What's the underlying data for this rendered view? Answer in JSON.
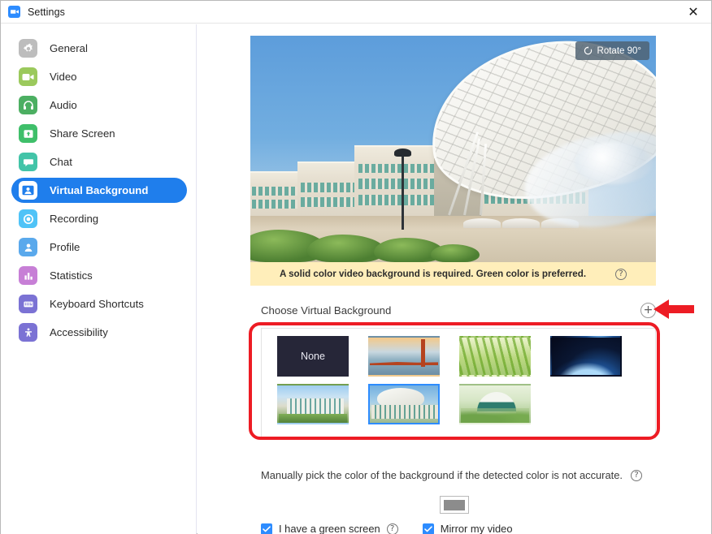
{
  "window": {
    "title": "Settings",
    "logo_icon": "zoom-logo-icon",
    "close_icon": "close-icon"
  },
  "sidebar": {
    "items": [
      {
        "label": "General",
        "icon": "gear-icon",
        "color": "#b9b9b9",
        "active": false
      },
      {
        "label": "Video",
        "icon": "video-icon",
        "color": "#9bc95c",
        "active": false
      },
      {
        "label": "Audio",
        "icon": "headphones-icon",
        "color": "#4caf62",
        "active": false
      },
      {
        "label": "Share Screen",
        "icon": "share-icon",
        "color": "#3fbf6a",
        "active": false
      },
      {
        "label": "Chat",
        "icon": "chat-icon",
        "color": "#42c4a8",
        "active": false
      },
      {
        "label": "Virtual Background",
        "icon": "person-icon",
        "color": "#ffffff",
        "active": true
      },
      {
        "label": "Recording",
        "icon": "record-icon",
        "color": "#4fc3f7",
        "active": false
      },
      {
        "label": "Profile",
        "icon": "profile-icon",
        "color": "#5aa9ec",
        "active": false
      },
      {
        "label": "Statistics",
        "icon": "bar-chart-icon",
        "color": "#c77fd6",
        "active": false
      },
      {
        "label": "Keyboard Shortcuts",
        "icon": "keyboard-icon",
        "color": "#7b72d4",
        "active": false
      },
      {
        "label": "Accessibility",
        "icon": "accessibility-icon",
        "color": "#7b72d4",
        "active": false
      }
    ],
    "active_color": "#1f7eec"
  },
  "main": {
    "preview": {
      "rotate_label": "Rotate 90°",
      "rotate_icon": "rotate-icon"
    },
    "warning": {
      "text": "A solid color video background is required. Green color is preferred.",
      "help_icon": "question-mark-icon",
      "background_color": "#ffeeba"
    },
    "choose": {
      "label": "Choose Virtual Background",
      "add_icon": "plus-circle-icon"
    },
    "thumbnails": [
      {
        "name": "none",
        "label": "None",
        "selected": false
      },
      {
        "name": "golden-gate",
        "label": "",
        "selected": false
      },
      {
        "name": "grass",
        "label": "",
        "selected": false
      },
      {
        "name": "earth",
        "label": "",
        "selected": false
      },
      {
        "name": "campus",
        "label": "",
        "selected": false
      },
      {
        "name": "canopy",
        "label": "",
        "selected": true
      },
      {
        "name": "green-building",
        "label": "",
        "selected": false
      }
    ],
    "manual": {
      "text": "Manually pick the color of the background if the detected color is not accurate.",
      "help_icon": "question-mark-icon",
      "swatch_color": "#8c8c8c"
    },
    "checkboxes": [
      {
        "label": "I have a green screen",
        "checked": true,
        "help_icon": "question-mark-icon"
      },
      {
        "label": "Mirror my video",
        "checked": true,
        "help_icon": ""
      }
    ]
  },
  "annotations": {
    "highlight_color": "#ed1c24",
    "rect_target": "thumbnail-panel",
    "arrow_target": "add-background-button"
  }
}
